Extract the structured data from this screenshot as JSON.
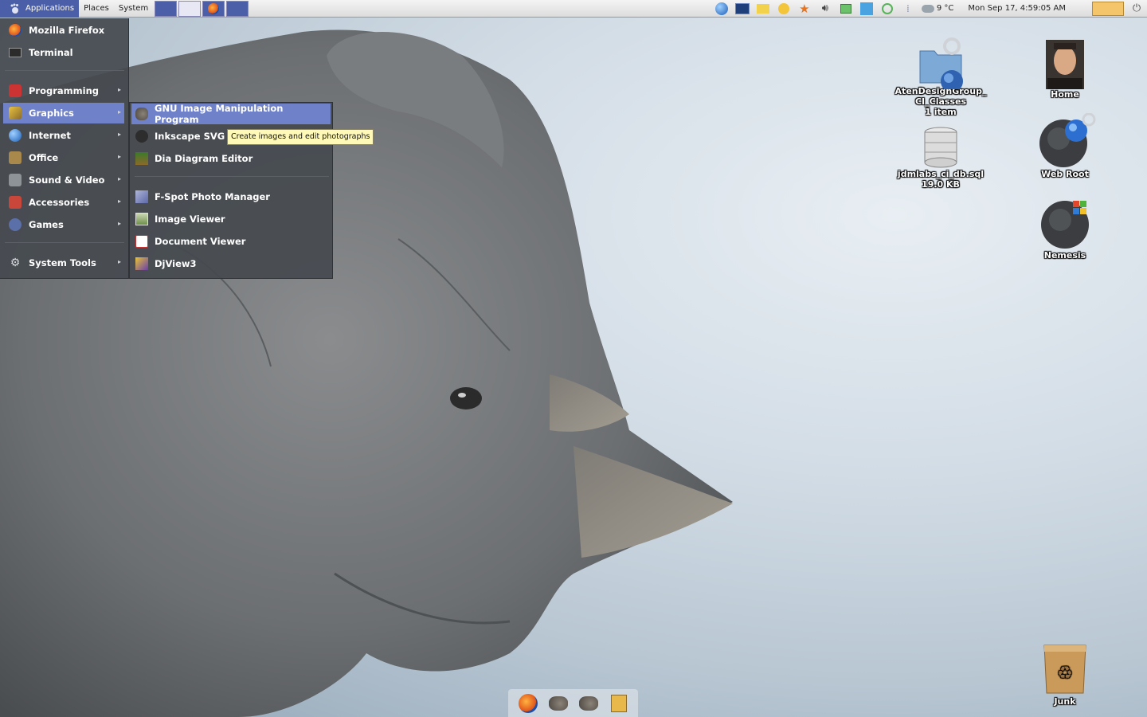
{
  "top_panel": {
    "menus": [
      "Applications",
      "Places",
      "System"
    ],
    "weather": "9 °C",
    "clock": "Mon Sep 17,  4:59:05 AM"
  },
  "apps_menu": {
    "items": [
      {
        "label": "Mozilla Firefox",
        "icon": "firefox-icon"
      },
      {
        "label": "Terminal",
        "icon": "terminal-icon"
      },
      {
        "label": "Programming",
        "icon": "programming-icon"
      },
      {
        "label": "Graphics",
        "icon": "graphics-icon"
      },
      {
        "label": "Internet",
        "icon": "internet-icon"
      },
      {
        "label": "Office",
        "icon": "office-icon"
      },
      {
        "label": "Sound & Video",
        "icon": "sound-video-icon"
      },
      {
        "label": "Accessories",
        "icon": "accessories-icon"
      },
      {
        "label": "Games",
        "icon": "games-icon"
      },
      {
        "label": "System Tools",
        "icon": "system-tools-icon"
      }
    ],
    "selected": "Graphics"
  },
  "graphics_submenu": {
    "items": [
      {
        "label": "GNU Image Manipulation Program",
        "icon": "gimp-icon"
      },
      {
        "label": "Inkscape SVG",
        "icon": "inkscape-icon"
      },
      {
        "label": "Dia Diagram Editor",
        "icon": "dia-icon"
      },
      {
        "label": "F-Spot Photo Manager",
        "icon": "fspot-icon"
      },
      {
        "label": "Image Viewer",
        "icon": "image-viewer-icon"
      },
      {
        "label": "Document Viewer",
        "icon": "document-viewer-icon"
      },
      {
        "label": "DjView3",
        "icon": "djview-icon"
      }
    ],
    "selected": "GNU Image Manipulation Program"
  },
  "tooltip": "Create images and edit photographs",
  "desktop_icons": [
    {
      "label": "AtenDesignGroup_\nCI_Classes\n1 item",
      "line1": "AtenDesignGroup_",
      "line2": "CI_Classes",
      "line3": "1 item",
      "icon": "network-folder-icon"
    },
    {
      "label": "jdmlabs_ci_db.sql",
      "line1": "jdmlabs_ci_db.sql",
      "line2": "19.0 KB",
      "icon": "database-icon"
    },
    {
      "label": "Home",
      "icon": "home-icon"
    },
    {
      "label": "Web Root",
      "icon": "web-root-icon"
    },
    {
      "label": "Nemesis",
      "icon": "nemesis-icon"
    },
    {
      "label": "Junk",
      "icon": "trash-icon"
    }
  ],
  "dock": [
    "firefox-icon",
    "gimp-icon",
    "gimp-icon",
    "notes-icon"
  ],
  "colors": {
    "menu_bg": "#464a50",
    "selection": "#6f81c9",
    "panel_active": "#4a5fa8",
    "tooltip_bg": "#fff9b8"
  }
}
